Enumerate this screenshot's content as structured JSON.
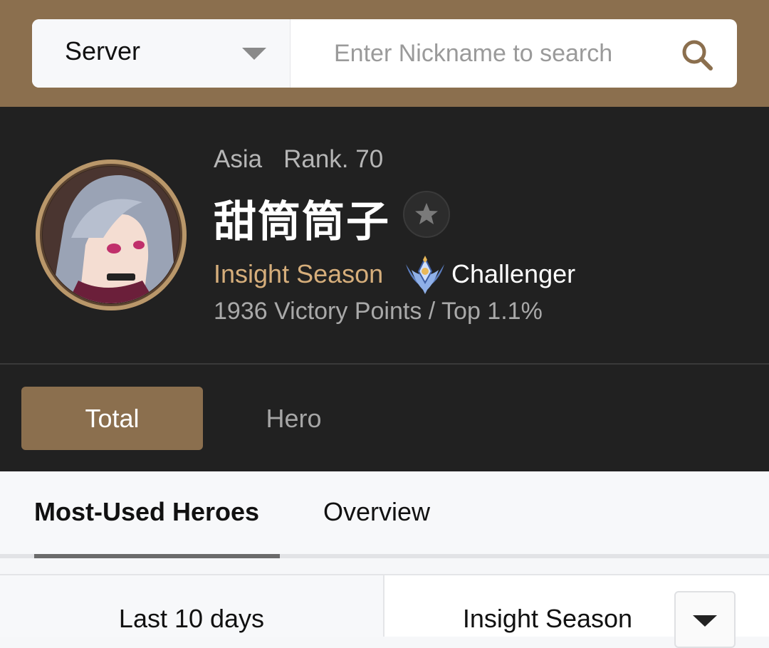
{
  "search": {
    "server_label": "Server",
    "placeholder": "Enter Nickname to search"
  },
  "profile": {
    "region": "Asia",
    "rank": "Rank. 70",
    "nickname": "甜筒筒子",
    "season": "Insight Season",
    "tier": "Challenger",
    "points": "1936 Victory Points / Top 1.1%"
  },
  "main_tabs": {
    "total": "Total",
    "hero": "Hero"
  },
  "sub_tabs": {
    "most_used": "Most-Used Heroes",
    "overview": "Overview"
  },
  "filters": {
    "period": "Last 10 days",
    "season": "Insight Season"
  },
  "colors": {
    "brand": "#8b6f4e",
    "panel": "#212121",
    "season_accent": "#d6ae7b"
  }
}
